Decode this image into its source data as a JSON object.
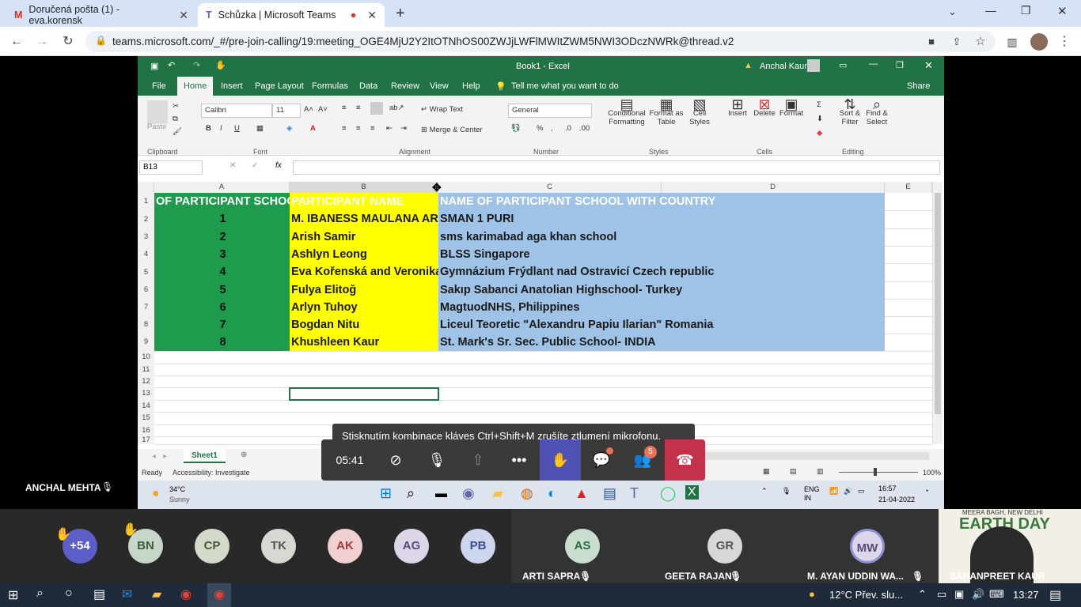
{
  "browser": {
    "tab1": "Doručená pošta (1) - eva.korensk",
    "tab2": "Schůzka | Microsoft Teams",
    "new_tab": "+",
    "url": "teams.microsoft.com/_#/pre-join-calling/19:meeting_OGE4MjU2Y2ItOTNhOS00ZWJjLWFlMWItZWM5NWI3ODczNWRk@thread.v2"
  },
  "excel": {
    "title": "Book1 - Excel",
    "user": "Anchal Kaur",
    "share": "Share",
    "menu": [
      "File",
      "Home",
      "Insert",
      "Page Layout",
      "Formulas",
      "Data",
      "Review",
      "View",
      "Help"
    ],
    "tell": "Tell me what you want to do",
    "ribbon": {
      "paste": "Paste",
      "font": "Calibri",
      "size": "11",
      "wrap": "Wrap Text",
      "merge": "Merge & Center",
      "numfmt": "General",
      "cond": "Conditional Formatting",
      "fmt_table": "Format as Table",
      "cell_styles": "Cell Styles",
      "insert": "Insert",
      "delete": "Delete",
      "format": "Format",
      "sort": "Sort & Filter",
      "find": "Find & Select",
      "groups": [
        "Clipboard",
        "Font",
        "Alignment",
        "Number",
        "Styles",
        "Cells",
        "Editing"
      ]
    },
    "namebox": "B13",
    "fx": "fx",
    "cols": [
      "A",
      "B",
      "C",
      "D",
      "E"
    ],
    "rows": [
      "1",
      "2",
      "3",
      "4",
      "5",
      "6",
      "7",
      "8",
      "9",
      "10",
      "11",
      "12",
      "13",
      "14",
      "15",
      "16",
      "17"
    ],
    "header": {
      "a": "OF PARTICIPANT SCHOOL",
      "b": "PARTICIPANT NAME",
      "c": "NAME OF PARTICIPANT SCHOOL WITH COUNTRY"
    },
    "data": [
      {
        "n": "1",
        "name": "M. IBANESS MAULANA AR",
        "school": "SMAN 1 PURI"
      },
      {
        "n": "2",
        "name": "Arish Samir",
        "school": "sms karimabad aga khan school"
      },
      {
        "n": "3",
        "name": "Ashlyn Leong",
        "school": "BLSS Singapore"
      },
      {
        "n": "4",
        "name": "Eva Kořenská and Veronika",
        "school": "Gymnázium Frýdlant nad Ostravicí Czech republic"
      },
      {
        "n": "5",
        "name": "Fulya Elitoğ",
        "school": "Sakıp Sabanci Anatolian Highschool- Turkey"
      },
      {
        "n": "6",
        "name": "Arlyn Tuhoy",
        "school": "MagtuodNHS, Philippines"
      },
      {
        "n": "7",
        "name": "Bogdan Nitu",
        "school": "Liceul Teoretic \"Alexandru Papiu Ilarian\" Romania"
      },
      {
        "n": "8",
        "name": "Khushleen Kaur",
        "school": "St. Mark's Sr. Sec. Public School- INDIA"
      }
    ],
    "sheet": "Sheet1",
    "status": "Ready",
    "accessibility": "Accessibility: Investigate",
    "zoom": "100%",
    "weather": {
      "temp": "34°C",
      "desc": "Sunny"
    },
    "lang": "ENG\nIN",
    "time": "16:57",
    "date": "21-04-2022"
  },
  "teams": {
    "toast": "Stisknutím kombinace kláves Ctrl+Shift+M zrušíte ztlumení mikrofonu.",
    "timer": "05:41",
    "chat_badge": "",
    "people_badge": "5",
    "presenter": "ANCHAL MEHTA",
    "participants": [
      {
        "initials": "+54"
      },
      {
        "initials": "BN"
      },
      {
        "initials": "CP"
      },
      {
        "initials": "TK"
      },
      {
        "initials": "AK"
      },
      {
        "initials": "AG"
      },
      {
        "initials": "PB"
      }
    ],
    "tiles": [
      {
        "initials": "AS",
        "name": "ARTI SAPRA"
      },
      {
        "initials": "GR",
        "name": "GEETA RAJAN"
      },
      {
        "initials": "MW",
        "name": "M. AYAN UDDIN WA..."
      }
    ],
    "video_name": "SARANPREET KAUR",
    "video_bg": "MEERA BAGH, NEW DELHI",
    "video_banner": "EARTH DAY"
  },
  "taskbar": {
    "weather": "12°C  Přev. slu...",
    "time": "13:27"
  }
}
